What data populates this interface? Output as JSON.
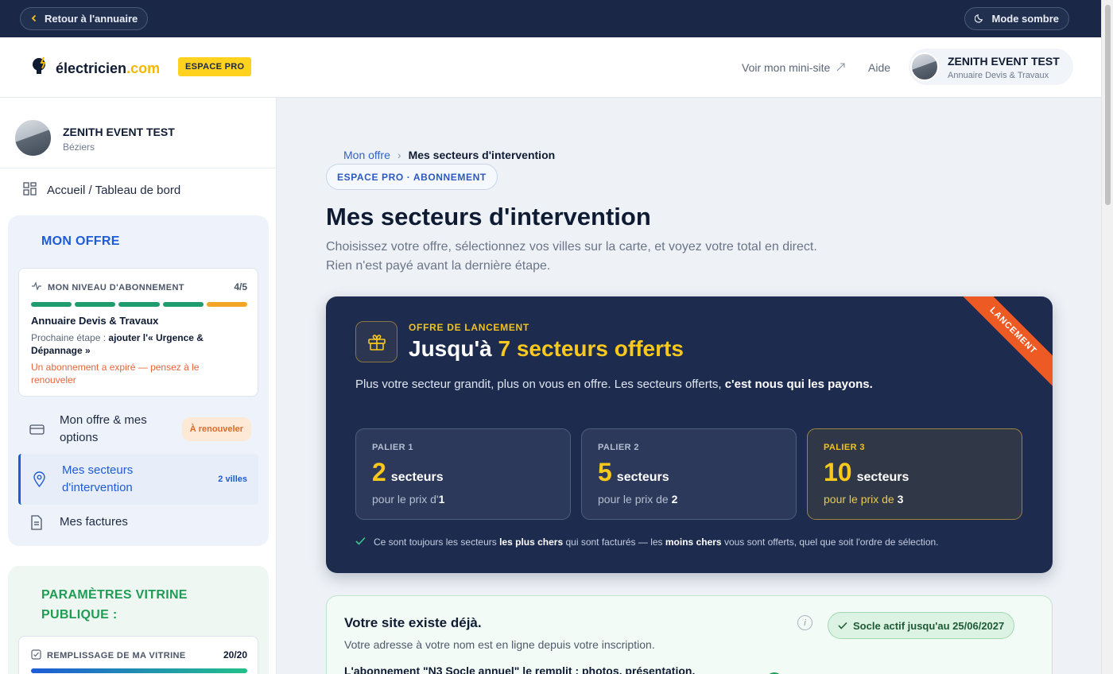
{
  "topbar": {
    "back_label": "Retour à l'annuaire",
    "dark_mode_label": "Mode sombre"
  },
  "header": {
    "logo_main": "électricien",
    "logo_suffix": ".com",
    "badge": "ESPACE PRO",
    "minisite_link": "Voir mon mini-site",
    "help_link": "Aide",
    "user_name": "ZENITH EVENT TEST",
    "user_sub": "Annuaire Devis & Travaux"
  },
  "sidebar": {
    "user_name": "ZENITH EVENT TEST",
    "user_city": "Béziers",
    "home_label": "Accueil / Tableau de bord",
    "offer_title": "MON OFFRE",
    "level": {
      "title": "MON NIVEAU D'ABONNEMENT",
      "score": "4/5",
      "plan": "Annuaire Devis & Travaux",
      "next_prefix": "Prochaine étape :",
      "next_step": "ajouter l'« Urgence & Dépannage »",
      "warning": "Un abonnement a expiré — pensez à le renouveler",
      "segments": [
        {
          "color": "#1f9d6e"
        },
        {
          "color": "#1f9d6e"
        },
        {
          "color": "#1f9d6e"
        },
        {
          "color": "#1f9d6e"
        },
        {
          "color": "#f3a626"
        }
      ]
    },
    "menu": [
      {
        "label": "Mon offre & mes options",
        "badge": "À renouveler"
      },
      {
        "label": "Mes secteurs d'intervention",
        "badge": "2 villes"
      },
      {
        "label": "Mes factures",
        "badge": ""
      }
    ],
    "vitrine_title": "PARAMÈTRES VITRINE PUBLIQUE :",
    "fill": {
      "title": "REMPLISSAGE DE MA VITRINE",
      "score": "20/20"
    }
  },
  "main": {
    "breadcrumb_parent": "Mon offre",
    "breadcrumb_sep": "›",
    "breadcrumb_current": "Mes secteurs d'intervention",
    "tag": "ESPACE PRO · ABONNEMENT",
    "title": "Mes secteurs d'intervention",
    "lead_1": "Choisissez votre offre, sélectionnez vos villes sur la carte, et voyez votre total en direct.",
    "lead_2": "Rien n'est payé avant la dernière étape.",
    "promo": {
      "ribbon": "LANCEMENT",
      "eyebrow": "OFFRE DE LANCEMENT",
      "title_prefix": "Jusqu'à",
      "title_highlight": "7 secteurs offerts",
      "text": "Plus votre secteur grandit, plus on vous en offre. Les secteurs offerts,",
      "text_bold": "c'est nous qui les payons.",
      "tiers": [
        {
          "label": "PALIER 1",
          "count": "2",
          "unit": "secteurs",
          "price_prefix": "pour le prix d'",
          "price": "1"
        },
        {
          "label": "PALIER 2",
          "count": "5",
          "unit": "secteurs",
          "price_prefix": "pour le prix de",
          "price": "2"
        },
        {
          "label": "PALIER 3",
          "count": "10",
          "unit": "secteurs",
          "price_prefix": "pour le prix de",
          "price": "3"
        }
      ],
      "note_1": "Ce sont toujours les secteurs",
      "note_2": "les plus chers",
      "note_3": "qui sont facturés — les",
      "note_4": "moins chers",
      "note_5": "vous sont offerts, quel que soit l'ordre de sélection."
    },
    "site": {
      "title": "Votre site existe déjà.",
      "desc": "Votre adresse à votre nom est en ligne depuis votre inscription.",
      "desc2": "L'abonnement \"N3 Socle annuel\" le remplit : photos, présentation,",
      "info": "i",
      "socle": "Socle actif jusqu'au 25/06/2027"
    }
  },
  "colors": {
    "accent": "#1e5bd8",
    "brand_yellow": "#ffd21f",
    "dark": "#1b2747",
    "promo_yellow": "#f8c81c",
    "ribbon": "#ee5a24"
  }
}
